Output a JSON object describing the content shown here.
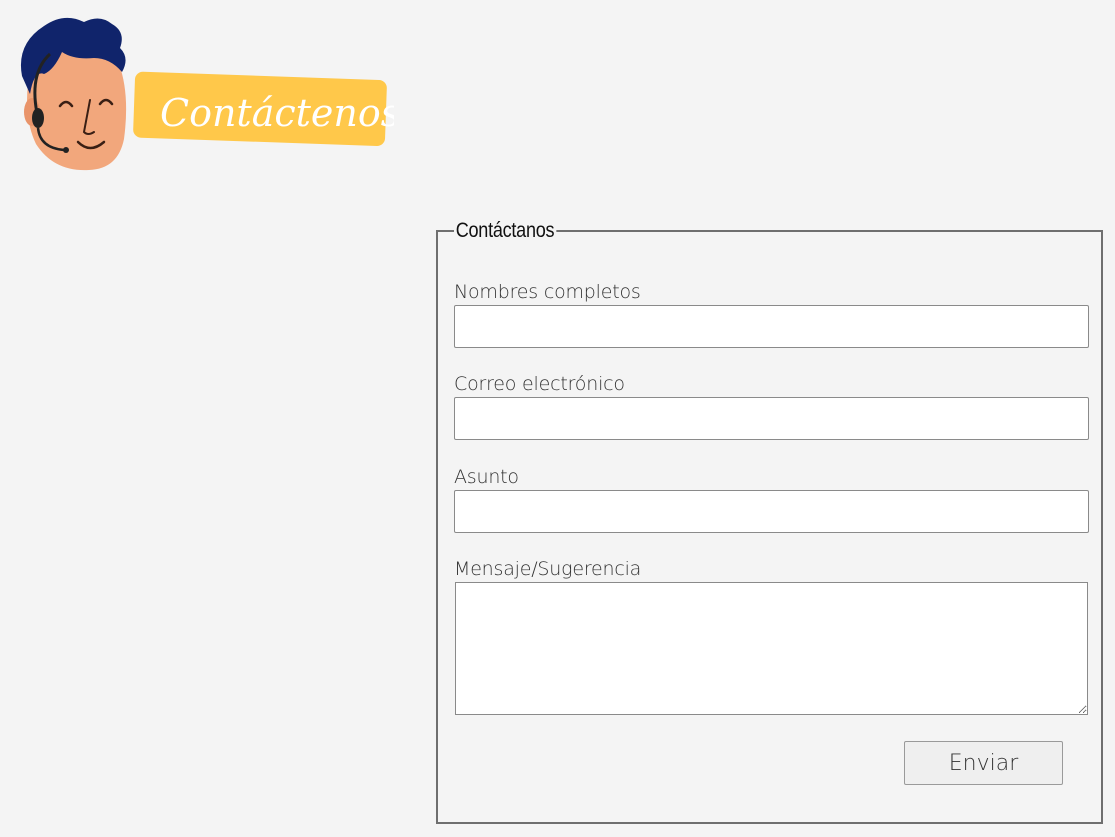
{
  "header": {
    "logo_text": "Contáctenos",
    "logo_icon": "support-agent-avatar-icon",
    "banner_color": "#ffc84a",
    "hair_color": "#10246b",
    "skin_color": "#f2a77c"
  },
  "form": {
    "legend": "Contáctanos",
    "fields": [
      {
        "label": "Nombres completos",
        "value": "",
        "type": "text"
      },
      {
        "label": "Correo electrónico",
        "value": "",
        "type": "email"
      },
      {
        "label": "Asunto",
        "value": "",
        "type": "text"
      },
      {
        "label": "Mensaje/Sugerencia",
        "value": "",
        "type": "textarea"
      }
    ],
    "submit_label": "Enviar"
  }
}
